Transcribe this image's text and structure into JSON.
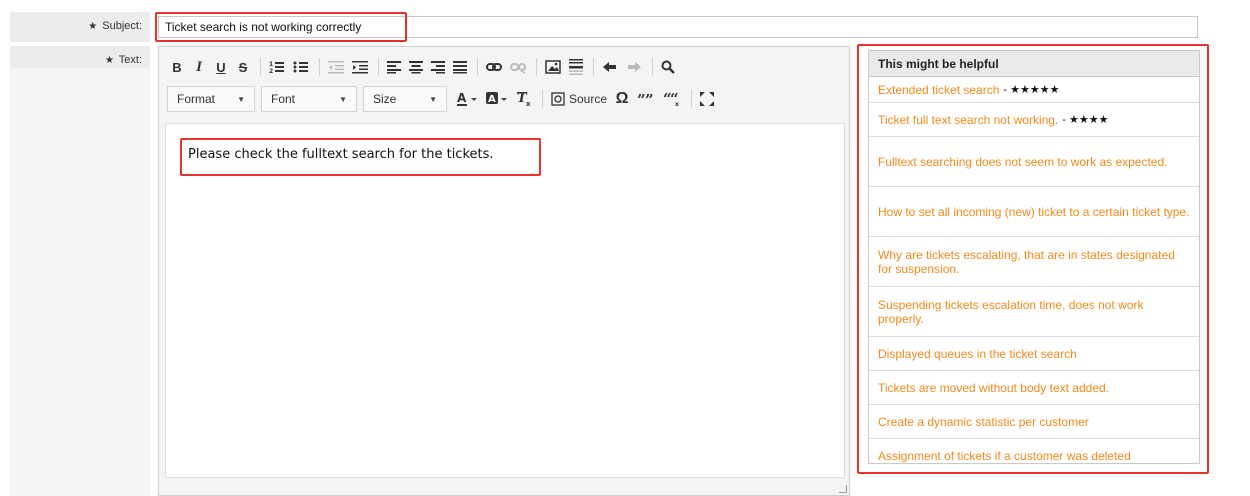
{
  "form": {
    "subject_label": "Subject:",
    "text_label": "Text:",
    "required_marker": "★",
    "subject_value": "Ticket search is not working correctly"
  },
  "toolbar": {
    "bold": "B",
    "italic": "I",
    "underline": "U",
    "strike": "S",
    "format_label": "Format",
    "font_label": "Font",
    "size_label": "Size",
    "source_label": "Source",
    "omega": "Ω"
  },
  "editor": {
    "body_text": "Please check the fulltext search for the tickets."
  },
  "help": {
    "title": "This might be helpful",
    "items": [
      {
        "title": "Extended ticket search",
        "rating": "- ★★★★★"
      },
      {
        "title": "Ticket full text search not working.",
        "rating": "- ★★★★"
      },
      {
        "title": "Fulltext searching does not seem to work as expected.",
        "rating": ""
      },
      {
        "title": "How to set all incoming (new) ticket to a certain ticket type.",
        "rating": ""
      },
      {
        "title": "Why are tickets escalating, that are in states designated for suspension.",
        "rating": ""
      },
      {
        "title": "Suspending tickets escalation time, does not work properly.",
        "rating": ""
      },
      {
        "title": "Displayed queues in the ticket search",
        "rating": ""
      },
      {
        "title": "Tickets are moved without body text added.",
        "rating": ""
      },
      {
        "title": "Create a dynamic statistic per customer",
        "rating": ""
      },
      {
        "title": "Assignment of tickets if a customer was deleted",
        "rating": ""
      }
    ]
  },
  "colors": {
    "highlight": "#e8322a",
    "link": "#f28a1c"
  }
}
